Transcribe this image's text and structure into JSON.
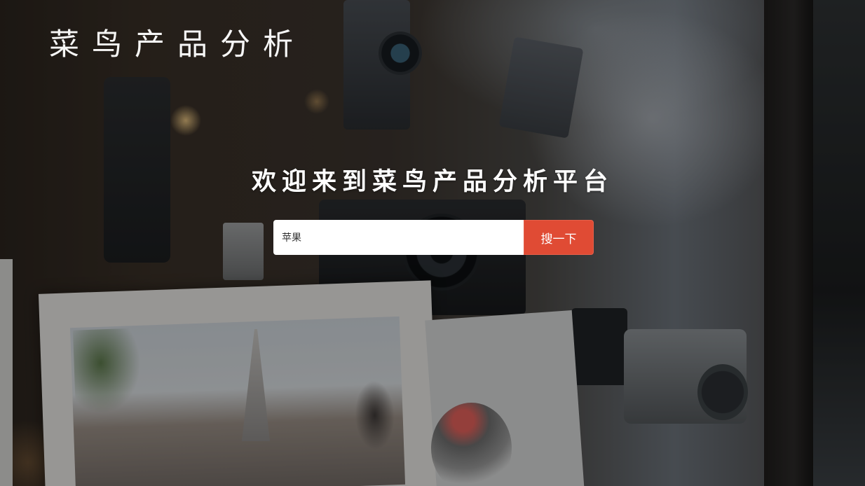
{
  "logo": {
    "chars": [
      "菜",
      "鸟",
      "产",
      "品",
      "分",
      "析"
    ]
  },
  "hero": {
    "title": "欢迎来到菜鸟产品分析平台"
  },
  "search": {
    "value": "苹果",
    "button_label": "搜一下"
  },
  "colors": {
    "accent": "#e04b34",
    "title": "#ffffff",
    "input_bg": "#ffffff"
  }
}
